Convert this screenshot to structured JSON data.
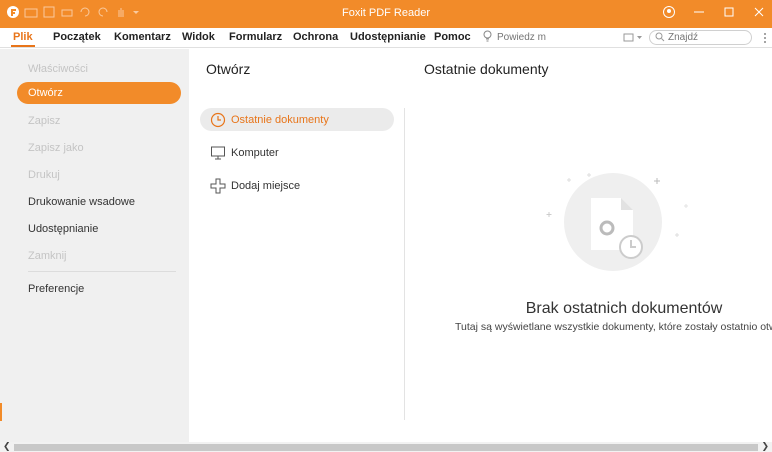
{
  "window": {
    "title": "Foxit PDF Reader"
  },
  "ribbon": {
    "tabs": [
      {
        "label": "Plik",
        "active": true
      },
      {
        "label": "Początek"
      },
      {
        "label": "Komentarz"
      },
      {
        "label": "Widok"
      },
      {
        "label": "Formularz"
      },
      {
        "label": "Ochrona"
      },
      {
        "label": "Udostępnianie"
      },
      {
        "label": "Pomoc"
      }
    ],
    "tell_me_placeholder": "Powiedz m",
    "find_placeholder": "Znajdź"
  },
  "backstage": {
    "nav": [
      {
        "label": "Właściwości",
        "state": "disabled"
      },
      {
        "label": "Otwórz",
        "state": "active"
      },
      {
        "label": "Zapisz",
        "state": "disabled"
      },
      {
        "label": "Zapisz jako",
        "state": "disabled"
      },
      {
        "label": "Drukuj",
        "state": "disabled"
      },
      {
        "label": "Drukowanie wsadowe",
        "state": "enabled"
      },
      {
        "label": "Udostępnianie",
        "state": "enabled"
      },
      {
        "label": "Zamknij",
        "state": "disabled"
      },
      {
        "label": "Preferencje",
        "state": "enabled"
      }
    ],
    "open": {
      "title": "Otwórz",
      "options": [
        {
          "label": "Ostatnie dokumenty",
          "icon": "clock-icon",
          "active": true
        },
        {
          "label": "Komputer",
          "icon": "monitor-icon"
        },
        {
          "label": "Dodaj miejsce",
          "icon": "add-place-icon"
        }
      ]
    },
    "recent": {
      "title": "Ostatnie dokumenty",
      "empty_heading": "Brak ostatnich dokumentów",
      "empty_text": "Tutaj są wyświetlane wszystkie dokumenty, które zostały ostatnio otwar"
    }
  },
  "colors": {
    "accent": "#f28b29",
    "accent_text": "#e8751a",
    "nav_bg": "#f0f0f0"
  }
}
